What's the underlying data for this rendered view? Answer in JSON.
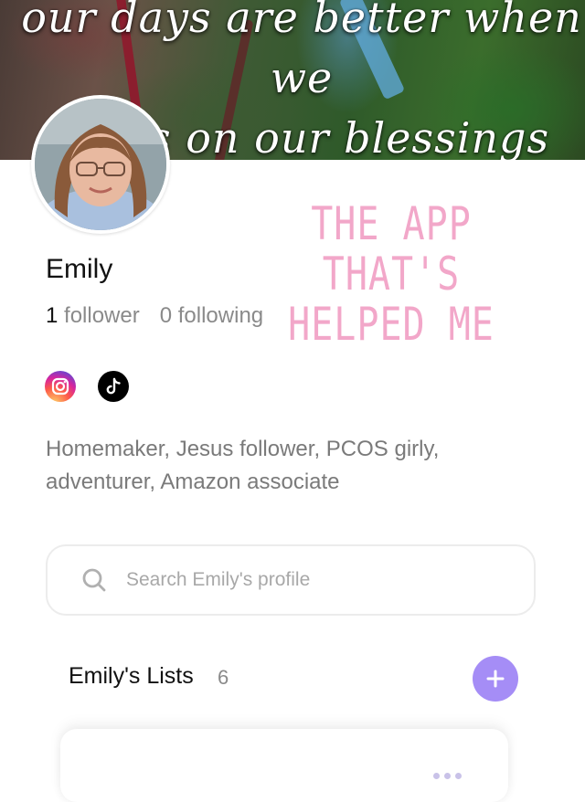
{
  "cover": {
    "quote": "our days are better when we\nfocus on our blessings more\nthan our problems."
  },
  "overlay": {
    "text": "THE APP THAT'S\nHELPED ME"
  },
  "profile": {
    "name": "Emily",
    "followers_count": "1",
    "followers_label": "follower",
    "following": "0 following",
    "bio": "Homemaker, Jesus follower, PCOS girly, adventurer, Amazon associate",
    "social_icons": [
      "instagram-icon",
      "tiktok-icon"
    ]
  },
  "search": {
    "placeholder": "Search Emily's profile",
    "value": ""
  },
  "lists": {
    "title": "Emily's Lists",
    "count": "6"
  },
  "colors": {
    "accent": "#a58df6",
    "overlay_pink": "#f2a7c9",
    "muted_text": "#8a8a8a"
  }
}
